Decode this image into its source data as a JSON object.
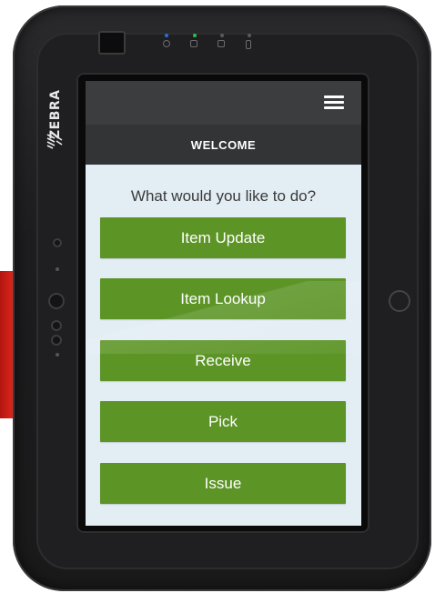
{
  "device": {
    "brand": "ZEBRA"
  },
  "app": {
    "header_title": "WELCOME",
    "prompt": "What would you like to do?",
    "accent_color": "#5c9426",
    "actions": [
      {
        "label": "Item Update"
      },
      {
        "label": "Item Lookup"
      },
      {
        "label": "Receive"
      },
      {
        "label": "Pick"
      },
      {
        "label": "Issue"
      }
    ]
  },
  "icons": {
    "menu": "hamburger-menu-icon",
    "brand_logo": "zebra-logo-icon"
  }
}
